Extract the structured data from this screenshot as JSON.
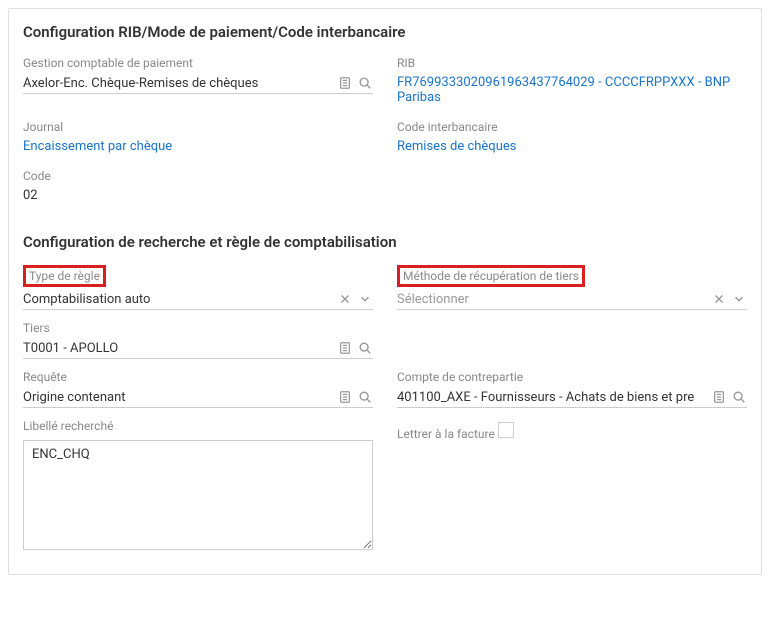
{
  "section1": {
    "title": "Configuration RIB/Mode de paiement/Code interbancaire",
    "gestion_label": "Gestion comptable de paiement",
    "gestion_value": "Axelor-Enc. Chèque-Remises de chèques",
    "rib_label": "RIB",
    "rib_value": "FR7699333020961963437764029 - CCCCFRPPXXX - BNP Paribas",
    "journal_label": "Journal",
    "journal_value": "Encaissement par chèque",
    "code_interbancaire_label": "Code interbancaire",
    "code_interbancaire_value": "Remises de chèques",
    "code_label": "Code",
    "code_value": "02"
  },
  "section2": {
    "title": "Configuration de recherche et règle de comptabilisation",
    "type_regle_label": "Type de règle",
    "type_regle_value": "Comptabilisation auto",
    "methode_label": "Méthode de récupération de tiers",
    "methode_value": "Sélectionner",
    "tiers_label": "Tiers",
    "tiers_value": "T0001 - APOLLO",
    "requete_label": "Requête",
    "requete_value": "Origine contenant",
    "compte_label": "Compte de contrepartie",
    "compte_value": "401100_AXE - Fournisseurs - Achats de biens et pre",
    "libelle_label": "Libellé recherché",
    "libelle_value": "ENC_CHQ",
    "lettrer_label": "Lettrer à la facture"
  }
}
